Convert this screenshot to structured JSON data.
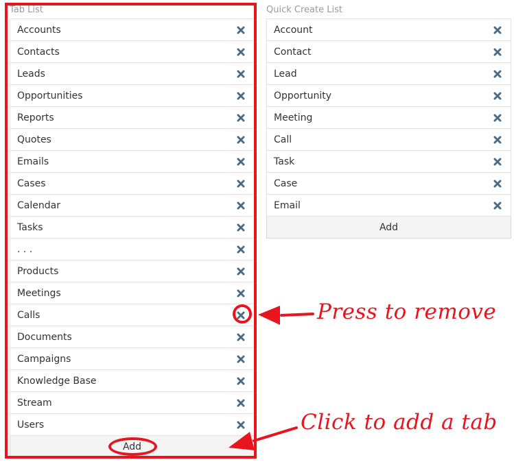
{
  "tab_list": {
    "title": "Tab List",
    "items": [
      {
        "label": "Accounts"
      },
      {
        "label": "Contacts"
      },
      {
        "label": "Leads"
      },
      {
        "label": "Opportunities"
      },
      {
        "label": "Reports"
      },
      {
        "label": "Quotes"
      },
      {
        "label": "Emails"
      },
      {
        "label": "Cases"
      },
      {
        "label": "Calendar"
      },
      {
        "label": "Tasks"
      },
      {
        "label": ". . ."
      },
      {
        "label": "Products"
      },
      {
        "label": "Meetings"
      },
      {
        "label": "Calls"
      },
      {
        "label": "Documents"
      },
      {
        "label": "Campaigns"
      },
      {
        "label": "Knowledge Base"
      },
      {
        "label": "Stream"
      },
      {
        "label": "Users"
      }
    ],
    "add_label": "Add"
  },
  "quick_create_list": {
    "title": "Quick Create List",
    "items": [
      {
        "label": "Account"
      },
      {
        "label": "Contact"
      },
      {
        "label": "Lead"
      },
      {
        "label": "Opportunity"
      },
      {
        "label": "Meeting"
      },
      {
        "label": "Call"
      },
      {
        "label": "Task"
      },
      {
        "label": "Case"
      },
      {
        "label": "Email"
      }
    ],
    "add_label": "Add"
  },
  "annotations": {
    "remove_text": "Press to remove",
    "add_text": "Click to add a tab",
    "color": "#e8141e"
  },
  "icons": {
    "remove": "close-icon"
  },
  "colors": {
    "icon": "#4b6a86",
    "border": "#e2e2e2",
    "add_bg": "#f4f4f4",
    "title": "#9a9a9a"
  }
}
